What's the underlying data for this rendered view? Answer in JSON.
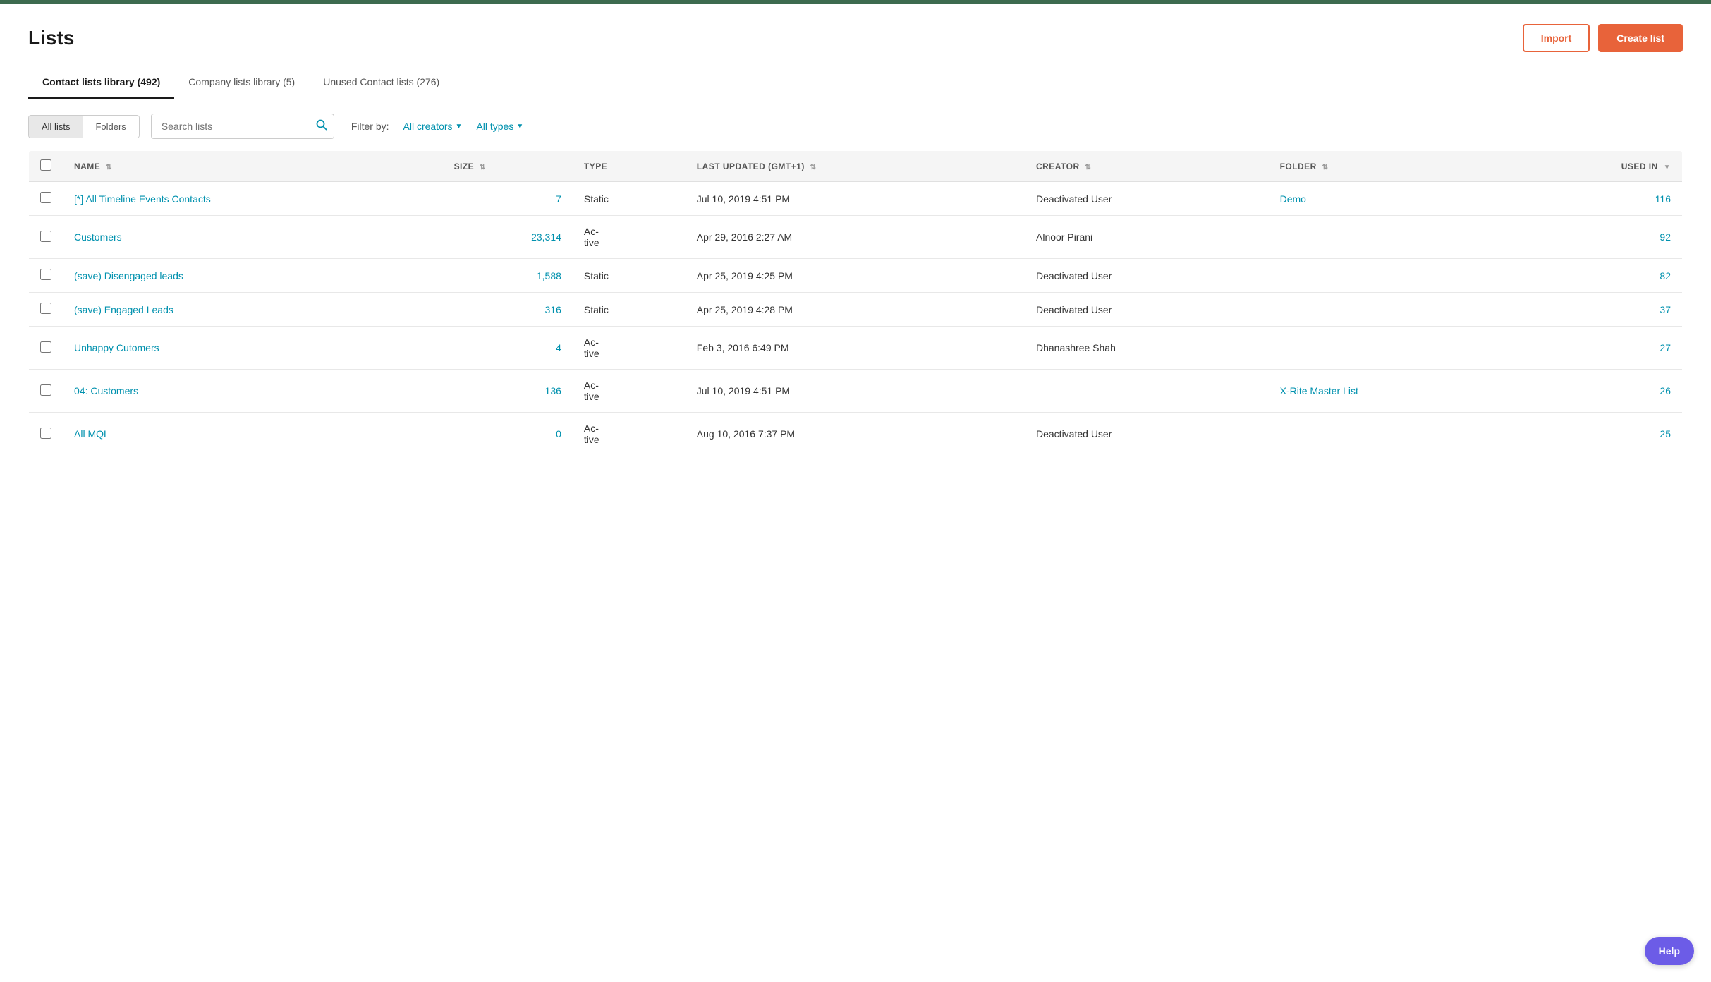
{
  "topbar": {},
  "header": {
    "title": "Lists",
    "import_label": "Import",
    "create_label": "Create list"
  },
  "tabs": [
    {
      "id": "contact",
      "label": "Contact lists library (492)",
      "active": true
    },
    {
      "id": "company",
      "label": "Company lists library (5)",
      "active": false
    },
    {
      "id": "unused",
      "label": "Unused Contact lists (276)",
      "active": false
    }
  ],
  "toolbar": {
    "all_lists_label": "All lists",
    "folders_label": "Folders",
    "search_placeholder": "Search lists",
    "filter_label": "Filter by:",
    "creators_label": "All creators",
    "types_label": "All types"
  },
  "table": {
    "columns": [
      {
        "id": "name",
        "label": "NAME",
        "sortable": true
      },
      {
        "id": "size",
        "label": "SIZE",
        "sortable": true
      },
      {
        "id": "type",
        "label": "TYPE",
        "sortable": false
      },
      {
        "id": "last_updated",
        "label": "LAST UPDATED (GMT+1)",
        "sortable": true
      },
      {
        "id": "creator",
        "label": "CREATOR",
        "sortable": true
      },
      {
        "id": "folder",
        "label": "FOLDER",
        "sortable": true
      },
      {
        "id": "used_in",
        "label": "USED IN",
        "sortable": true
      }
    ],
    "rows": [
      {
        "name": "[*] All Timeline Events Contacts",
        "size": "7",
        "type": "Static",
        "last_updated": "Jul 10, 2019 4:51 PM",
        "creator": "Deactivated User",
        "folder": "Demo",
        "folder_link": true,
        "used_in": "116"
      },
      {
        "name": "Customers",
        "size": "23,314",
        "type": "Ac-\ntive",
        "last_updated": "Apr 29, 2016 2:27 AM",
        "creator": "Alnoor Pirani",
        "folder": "",
        "folder_link": false,
        "used_in": "92"
      },
      {
        "name": "(save) Disengaged leads",
        "size": "1,588",
        "type": "Static",
        "last_updated": "Apr 25, 2019 4:25 PM",
        "creator": "Deactivated User",
        "folder": "",
        "folder_link": false,
        "used_in": "82"
      },
      {
        "name": "(save) Engaged Leads",
        "size": "316",
        "type": "Static",
        "last_updated": "Apr 25, 2019 4:28 PM",
        "creator": "Deactivated User",
        "folder": "",
        "folder_link": false,
        "used_in": "37"
      },
      {
        "name": "Unhappy Cutomers",
        "size": "4",
        "type": "Ac-\ntive",
        "last_updated": "Feb 3, 2016 6:49 PM",
        "creator": "Dhanashree Shah",
        "folder": "",
        "folder_link": false,
        "used_in": "27"
      },
      {
        "name": "04: Customers",
        "size": "136",
        "type": "Ac-\ntive",
        "last_updated": "Jul 10, 2019 4:51 PM",
        "creator": "",
        "folder": "X-Rite Master List",
        "folder_link": true,
        "used_in": "26"
      },
      {
        "name": "All MQL",
        "size": "0",
        "type": "Ac-\ntive",
        "last_updated": "Aug 10, 2016 7:37 PM",
        "creator": "Deactivated User",
        "folder": "",
        "folder_link": false,
        "used_in": "25"
      }
    ]
  },
  "help": {
    "label": "Help"
  }
}
